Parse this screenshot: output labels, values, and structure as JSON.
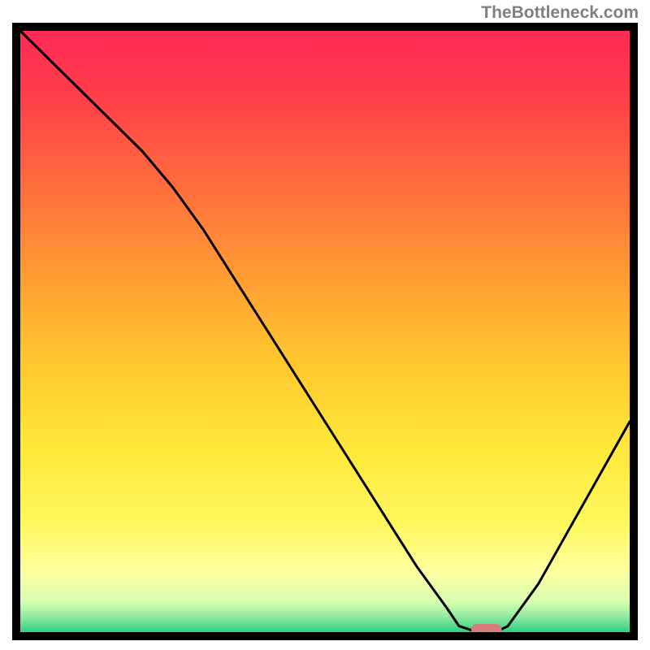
{
  "watermark": "TheBottleneck.com",
  "chart_data": {
    "type": "line",
    "title": "",
    "xlabel": "",
    "ylabel": "",
    "xlim": [
      0,
      100
    ],
    "ylim": [
      0,
      100
    ],
    "series": [
      {
        "name": "curve",
        "x": [
          0,
          5,
          10,
          15,
          20,
          25,
          30,
          35,
          40,
          45,
          50,
          55,
          60,
          65,
          70,
          72,
          75,
          78,
          80,
          85,
          90,
          95,
          100
        ],
        "values": [
          100,
          95,
          90,
          85,
          80,
          74,
          67,
          59,
          51,
          43,
          35,
          27,
          19,
          11,
          4,
          1,
          0,
          0,
          1,
          8,
          17,
          26,
          35
        ]
      }
    ],
    "marker": {
      "x_start": 74,
      "x_end": 79,
      "y": 0,
      "color": "#d87b7b"
    },
    "background_gradient": {
      "stops": [
        {
          "offset": 0.0,
          "color": "#ff2a55"
        },
        {
          "offset": 0.1,
          "color": "#ff3b4a"
        },
        {
          "offset": 0.25,
          "color": "#ff6b3d"
        },
        {
          "offset": 0.4,
          "color": "#ff9a33"
        },
        {
          "offset": 0.55,
          "color": "#ffc72e"
        },
        {
          "offset": 0.7,
          "color": "#ffe93a"
        },
        {
          "offset": 0.82,
          "color": "#fff85e"
        },
        {
          "offset": 0.9,
          "color": "#fdffa0"
        },
        {
          "offset": 0.95,
          "color": "#d6ffb0"
        },
        {
          "offset": 0.975,
          "color": "#8fe8a0"
        },
        {
          "offset": 1.0,
          "color": "#2fcf80"
        }
      ]
    },
    "frame_border_width": 10,
    "curve_stroke_width": 3
  }
}
